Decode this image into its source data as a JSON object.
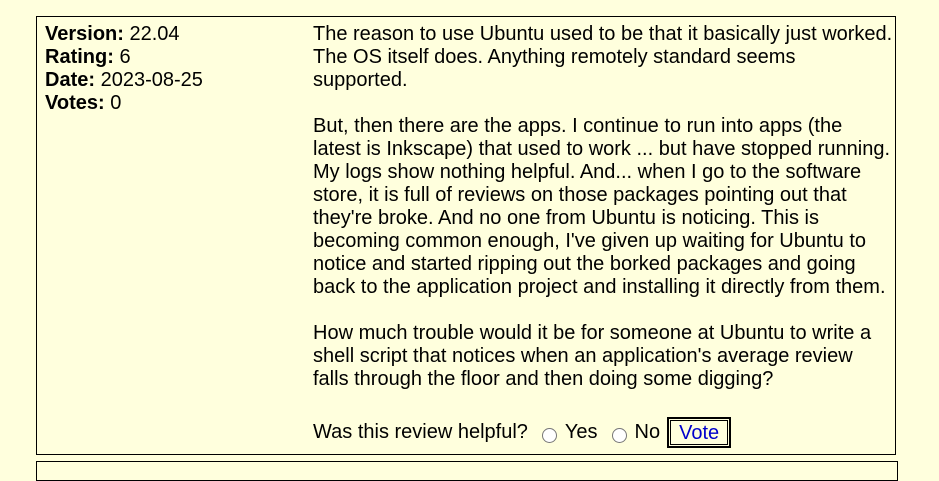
{
  "review": {
    "meta": [
      {
        "key": "Version:",
        "value": "22.04"
      },
      {
        "key": "Rating:",
        "value": "6"
      },
      {
        "key": "Date:",
        "value": "2023-08-25"
      },
      {
        "key": "Votes:",
        "value": "0"
      }
    ],
    "paragraphs": [
      "The reason to use Ubuntu used to be that it basically just worked. The OS itself does. Anything remotely standard seems supported.",
      "But, then there are the apps. I continue to run into apps (the latest is Inkscape) that used to work ... but have stopped running. My logs show nothing helpful. And... when I go to the software store, it is full of reviews on those packages pointing out that they're broke. And no one from Ubuntu is noticing. This is becoming common enough, I've given up waiting for Ubuntu to notice and started ripping out the borked packages and going back to the application project and installing it directly from them.",
      "How much trouble would it be for someone at Ubuntu to write a shell script that notices when an application's average review falls through the floor and then doing some digging?"
    ],
    "vote": {
      "question": "Was this review helpful?",
      "yes_label": "Yes",
      "no_label": "No",
      "button_label": "Vote"
    }
  }
}
